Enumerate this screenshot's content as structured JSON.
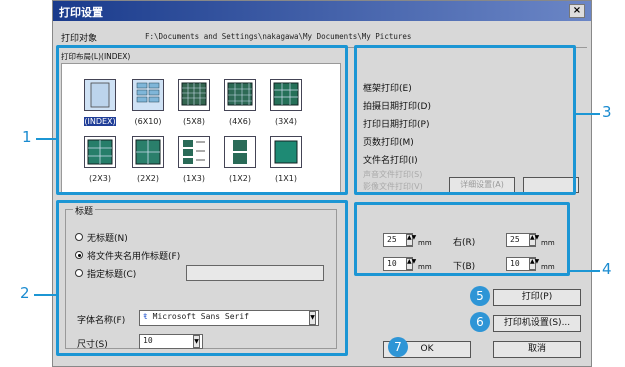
{
  "dialog": {
    "title": "打印设置",
    "close": "×",
    "print_target_label": "打印对象",
    "print_target_path": "F:\\Documents and Settings\\nakagawa\\My Documents\\My Pictures"
  },
  "layout": {
    "section_label": "打印布局(L)(INDEX)",
    "thumbnails_row1": [
      {
        "label": "(INDEX)",
        "selected": true
      },
      {
        "label": "(6X10)",
        "selected": false
      },
      {
        "label": "(5X8)",
        "selected": false
      },
      {
        "label": "(4X6)",
        "selected": false
      },
      {
        "label": "(3X4)",
        "selected": false
      }
    ],
    "thumbnails_row2": [
      {
        "label": "(2X3)",
        "selected": false
      },
      {
        "label": "(2X2)",
        "selected": false
      },
      {
        "label": "(1X3)",
        "selected": false
      },
      {
        "label": "(1X2)",
        "selected": false
      },
      {
        "label": "(1X1)",
        "selected": false
      }
    ]
  },
  "title_options": {
    "group_label": "标题",
    "no_title": "无标题(N)",
    "use_filename": "将文件夹名用作标题(F)",
    "custom_title": "指定标题(C)",
    "custom_value": "",
    "font_label": "字体名称(F)",
    "font_value": "Microsoft Sans Serif",
    "size_label": "尺寸(S)",
    "size_value": "10"
  },
  "print_options": {
    "frame": "框架打印(E)",
    "shooting_date": "拍摄日期打印(D)",
    "print_date": "打印日期打印(P)",
    "page_number": "页数打印(M)",
    "filename": "文件名打印(I)",
    "disabled1": "声音文件打印(S)",
    "disabled2": "影像文件打印(V)",
    "detail_button": "详细设置(A)"
  },
  "margins": {
    "top_value": "25",
    "right_label": "右(R)",
    "right_value": "25",
    "bottom_label": "下(B)",
    "bottom_value": "10",
    "left_value": "10",
    "unit": "mm"
  },
  "buttons": {
    "print": "打印(P)",
    "printer_setup": "打印机设置(S)...",
    "ok": "OK",
    "cancel": "取消"
  },
  "callouts": {
    "n1": "1",
    "n2": "2",
    "n3": "3",
    "n4": "4",
    "n5": "5",
    "n6": "6",
    "n7": "7"
  },
  "colors": {
    "highlight": "#1c96d4",
    "callout_text": "#1a8bd0"
  }
}
